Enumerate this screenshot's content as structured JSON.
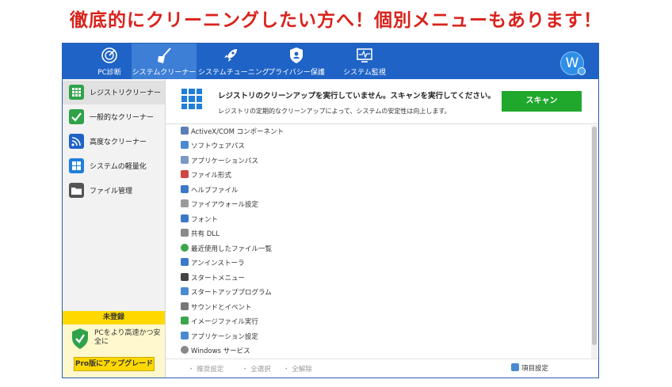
{
  "banner": {
    "text": "徹底的にクリーニングしたい方へ！個別メニューもあります！"
  },
  "nav": {
    "items": [
      {
        "label": "PC診断",
        "icon": "radar-icon"
      },
      {
        "label": "システムクリーナー",
        "icon": "broom-icon",
        "active": true
      },
      {
        "label": "システムチューニング",
        "icon": "rocket-icon"
      },
      {
        "label": "プライバシー保護",
        "icon": "shield-icon"
      },
      {
        "label": "システム監視",
        "icon": "monitor-icon"
      }
    ],
    "avatar_letter": "W"
  },
  "sidebar": {
    "items": [
      {
        "label": "レジストリクリーナー",
        "icon": "registry-grid-icon",
        "color": "#2fa24a",
        "active": true
      },
      {
        "label": "一般的なクリーナー",
        "icon": "broom-check-icon",
        "color": "#2fa24a"
      },
      {
        "label": "高度なクリーナー",
        "icon": "wifi-signal-icon",
        "color": "#1f63c6"
      },
      {
        "label": "システムの軽量化",
        "icon": "windows-icon",
        "color": "#1f7fd8"
      },
      {
        "label": "ファイル管理",
        "icon": "folder-icon",
        "color": "#555555"
      }
    ],
    "promo": {
      "status": "未登録",
      "text": "PCをより高速かつ安全に",
      "upgrade": "Pro版にアップグレード"
    }
  },
  "header": {
    "title": "レジストリのクリーンアップを実行していません。スキャンを実行してください。",
    "subtitle": "レジストリの定期的なクリーンアップによって、システムの安定性は向上します。",
    "scan_button": "スキャン"
  },
  "list": {
    "items": [
      {
        "label": "ActiveX/COM コンポーネント",
        "icon": "activex-icon",
        "color": "#5b7fb5"
      },
      {
        "label": "ソフトウェアパス",
        "icon": "software-path-icon",
        "color": "#4a8ad1"
      },
      {
        "label": "アプリケーションパス",
        "icon": "app-path-icon",
        "color": "#7a98c4"
      },
      {
        "label": "ファイル形式",
        "icon": "file-type-icon",
        "color": "#d04545"
      },
      {
        "label": "ヘルプファイル",
        "icon": "help-file-icon",
        "color": "#3b78c9"
      },
      {
        "label": "ファイアウォール設定",
        "icon": "firewall-icon",
        "color": "#9a9a9a"
      },
      {
        "label": "フォント",
        "icon": "font-icon",
        "color": "#3b78c9"
      },
      {
        "label": "共有 DLL",
        "icon": "dll-icon",
        "color": "#8a8a8a"
      },
      {
        "label": "最近使用したファイル一覧",
        "icon": "recent-files-icon",
        "color": "#3aa64a"
      },
      {
        "label": "アンインストーラ",
        "icon": "uninstaller-icon",
        "color": "#3b78c9"
      },
      {
        "label": "スタートメニュー",
        "icon": "start-menu-icon",
        "color": "#444444"
      },
      {
        "label": "スタートアッププログラム",
        "icon": "startup-icon",
        "color": "#4a8ad1"
      },
      {
        "label": "サウンドとイベント",
        "icon": "sound-icon",
        "color": "#777777"
      },
      {
        "label": "イメージファイル実行",
        "icon": "image-exec-icon",
        "color": "#3aa64a"
      },
      {
        "label": "アプリケーション設定",
        "icon": "app-settings-icon",
        "color": "#4a8ad1"
      },
      {
        "label": "Windows サービス",
        "icon": "windows-service-icon",
        "color": "#888888"
      }
    ]
  },
  "footer": {
    "links": [
      "推奨設定",
      "全選択",
      "全解除"
    ],
    "settings": "項目設定"
  },
  "colors": {
    "topbar": "#1f63c6",
    "scan": "#1fa82c",
    "promo": "#ffd800",
    "banner": "#d9221c"
  }
}
